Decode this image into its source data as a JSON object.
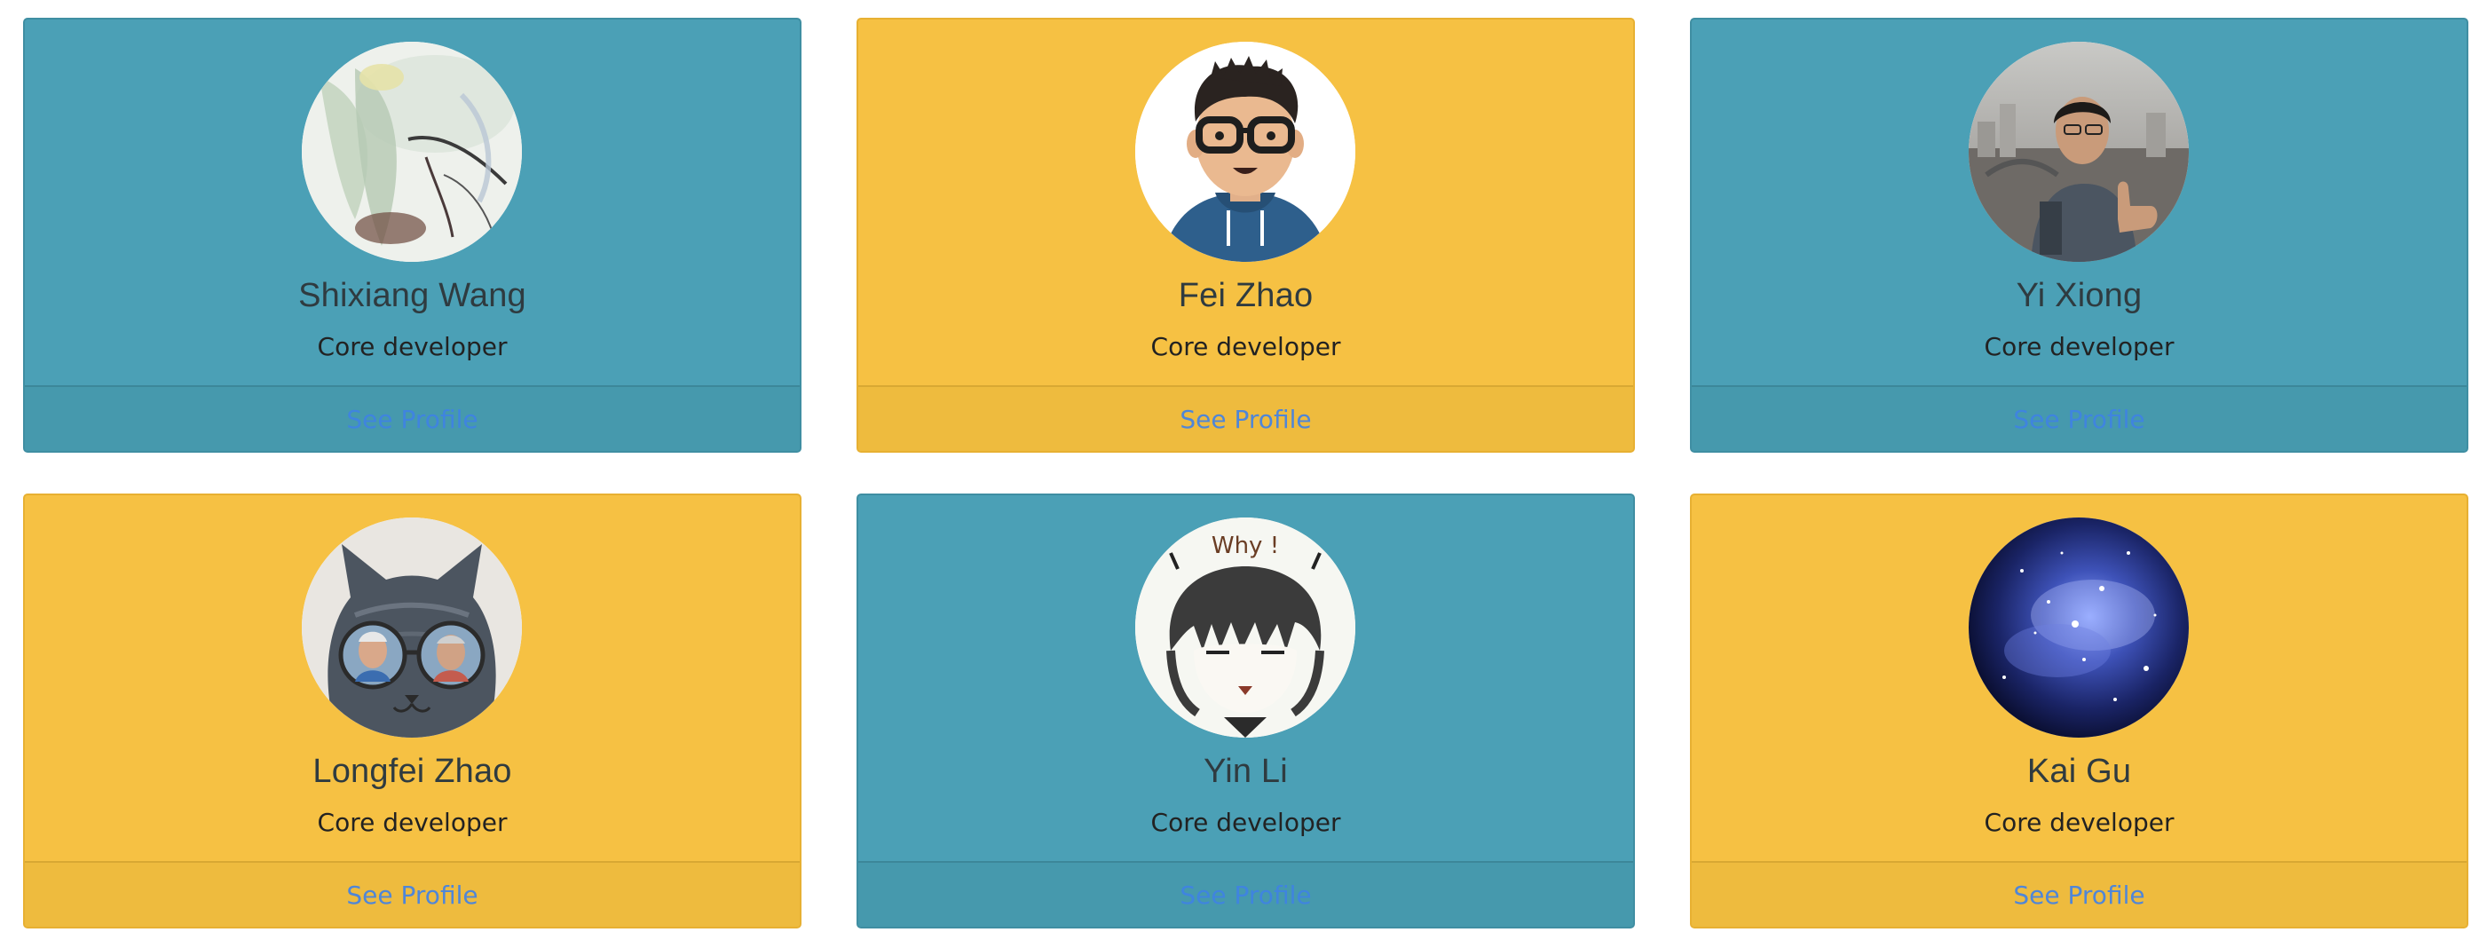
{
  "profiles": [
    {
      "name": "Shixiang Wang",
      "role": "Core developer",
      "link": "See Profile",
      "theme": "teal",
      "avatar": "watercolor-leaf-avatar"
    },
    {
      "name": "Fei Zhao",
      "role": "Core developer",
      "link": "See Profile",
      "theme": "yellow",
      "avatar": "cartoon-person-avatar"
    },
    {
      "name": "Yi Xiong",
      "role": "Core developer",
      "link": "See Profile",
      "theme": "teal",
      "avatar": "photo-thumbs-up-avatar"
    },
    {
      "name": "Longfei Zhao",
      "role": "Core developer",
      "link": "See Profile",
      "theme": "yellow",
      "avatar": "cat-with-glasses-avatar"
    },
    {
      "name": "Yin Li",
      "role": "Core developer",
      "link": "See Profile",
      "theme": "teal",
      "avatar": "anime-boy-avatar",
      "avatar_text": "Why !"
    },
    {
      "name": "Kai Gu",
      "role": "Core developer",
      "link": "See Profile",
      "theme": "yellow",
      "avatar": "galaxy-avatar"
    }
  ],
  "colors": {
    "teal": "#4ba0b6",
    "yellow": "#f6c143",
    "link_blue": "#4f86d8"
  }
}
